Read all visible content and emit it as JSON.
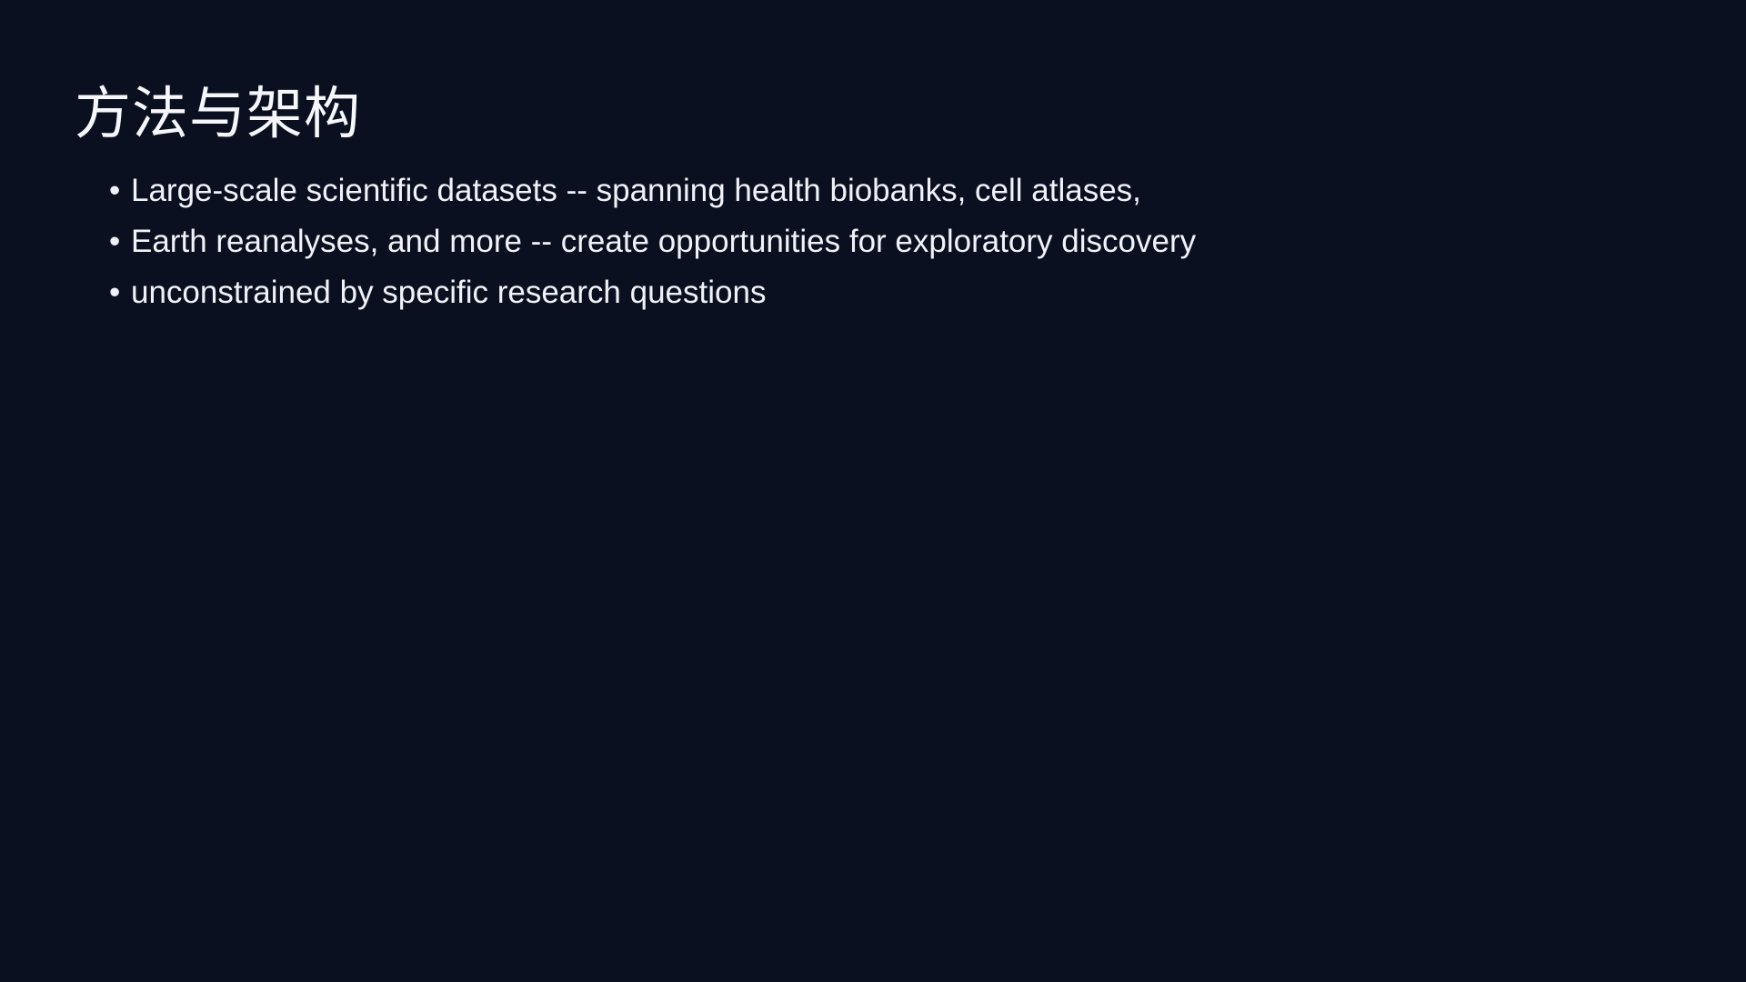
{
  "slide": {
    "title": "方法与架构",
    "bullets": [
      {
        "marker": "•",
        "text": "Large-scale scientific datasets -- spanning health biobanks, cell atlases,"
      },
      {
        "marker": "•",
        "text": "Earth reanalyses, and more -- create opportunities for exploratory discovery"
      },
      {
        "marker": "•",
        "text": "unconstrained by specific research questions"
      }
    ]
  },
  "colors": {
    "background": "#0b1020",
    "text": "#f0f2f7"
  }
}
